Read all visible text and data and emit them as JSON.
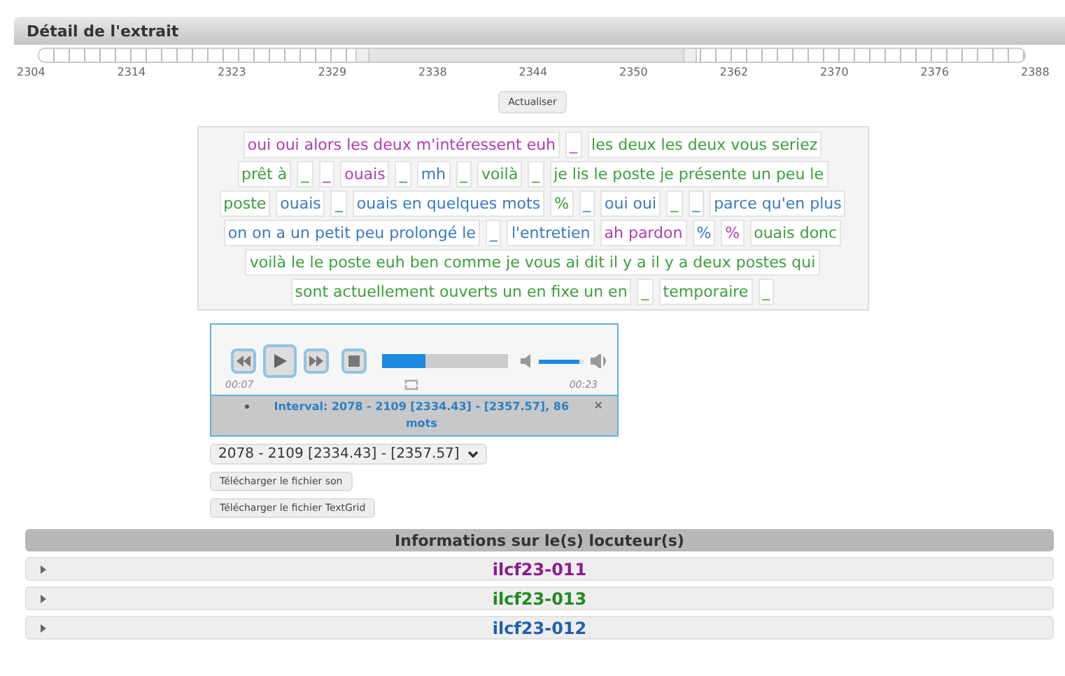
{
  "panel": {
    "title": "Détail de l'extrait"
  },
  "timeline": {
    "handles": [
      {
        "level": 0.327
      },
      {
        "level": 0.659
      }
    ],
    "labels": [
      "2304",
      "2314",
      "2323",
      "2329",
      "2338",
      "2344",
      "2350",
      "2362",
      "2370",
      "2376",
      "2388"
    ]
  },
  "refresh_button": "Actualiser",
  "transcript_lines": [
    {
      "segments": [
        {
          "text": "oui oui alors les deux m'intéressent euh",
          "color": "#b13cb1"
        },
        {
          "text": "_",
          "color": "#b13cb1"
        },
        {
          "text": "les deux les deux vous seriez",
          "color": "#3c9f3c"
        }
      ]
    },
    {
      "segments": [
        {
          "text": "prêt à",
          "color": "#3c9f3c"
        },
        {
          "text": "_",
          "color": "#3c9f3c"
        },
        {
          "text": "_",
          "color": "#b13cb1"
        },
        {
          "text": "ouais",
          "color": "#b13cb1"
        },
        {
          "text": "_",
          "color": "#3a78c8"
        },
        {
          "text": "mh",
          "color": "#3a78c8"
        },
        {
          "text": "_",
          "color": "#3c9f3c"
        },
        {
          "text": "voilà",
          "color": "#3c9f3c"
        },
        {
          "text": "_",
          "color": "#3c9f3c"
        },
        {
          "text": "je lis le poste je présente un peu le",
          "color": "#3c9f3c"
        }
      ]
    },
    {
      "segments": [
        {
          "text": "poste",
          "color": "#3c9f3c"
        },
        {
          "text": "ouais",
          "color": "#3a78c8"
        },
        {
          "text": "_",
          "color": "#3a78c8"
        },
        {
          "text": "ouais en quelques mots",
          "color": "#3a78c8"
        },
        {
          "text": "%",
          "color": "#3c9f3c"
        },
        {
          "text": "_",
          "color": "#3a78c8"
        },
        {
          "text": "oui oui",
          "color": "#3a78c8"
        },
        {
          "text": "_",
          "color": "#3c9f3c"
        },
        {
          "text": "_",
          "color": "#3a78c8"
        },
        {
          "text": "parce qu'en plus",
          "color": "#3a78c8"
        }
      ]
    },
    {
      "segments": [
        {
          "text": "on on a un petit peu prolongé le",
          "color": "#3a78c8"
        },
        {
          "text": "_",
          "color": "#3a78c8"
        },
        {
          "text": "l'entretien",
          "color": "#3a78c8"
        },
        {
          "text": "ah pardon",
          "color": "#b13cb1"
        },
        {
          "text": "%",
          "color": "#3a78c8"
        },
        {
          "text": "%",
          "color": "#b13cb1"
        },
        {
          "text": "ouais donc",
          "color": "#3c9f3c"
        }
      ]
    },
    {
      "segments": [
        {
          "text": "voilà le le poste euh ben comme je vous ai dit il y a il y a deux postes qui",
          "color": "#3c9f3c"
        }
      ]
    },
    {
      "segments": [
        {
          "text": "sont actuellement ouverts un en fixe un en",
          "color": "#3c9f3c"
        },
        {
          "text": "_",
          "color": "#3c9f3c"
        },
        {
          "text": "temporaire",
          "color": "#3c9f3c"
        },
        {
          "text": "_",
          "color": "#3c9f3c"
        }
      ]
    }
  ],
  "player": {
    "progress": {
      "level": 0.34
    },
    "volume": {
      "level": 0.9
    },
    "elapsed": "00:07",
    "duration": "00:23",
    "interval": "Interval: 2078 - 2109 [2334.43] - [2357.57], 86 mots",
    "remove": "×"
  },
  "interval_select": {
    "value": "2078 - 2109 [2334.43] - [2357.57]"
  },
  "download_buttons": [
    "Télécharger le fichier son",
    "Télécharger le fichier TextGrid"
  ],
  "speakers": {
    "title": "Informations sur le(s) locuteur(s)",
    "items": [
      {
        "name": "ilcf23-011",
        "color": "#8e1a8e",
        "expanded": false
      },
      {
        "name": "ilcf23-013",
        "color": "#1f8a1f",
        "expanded": false
      },
      {
        "name": "ilcf23-012",
        "color": "#1f5fb0",
        "expanded": false
      }
    ]
  }
}
